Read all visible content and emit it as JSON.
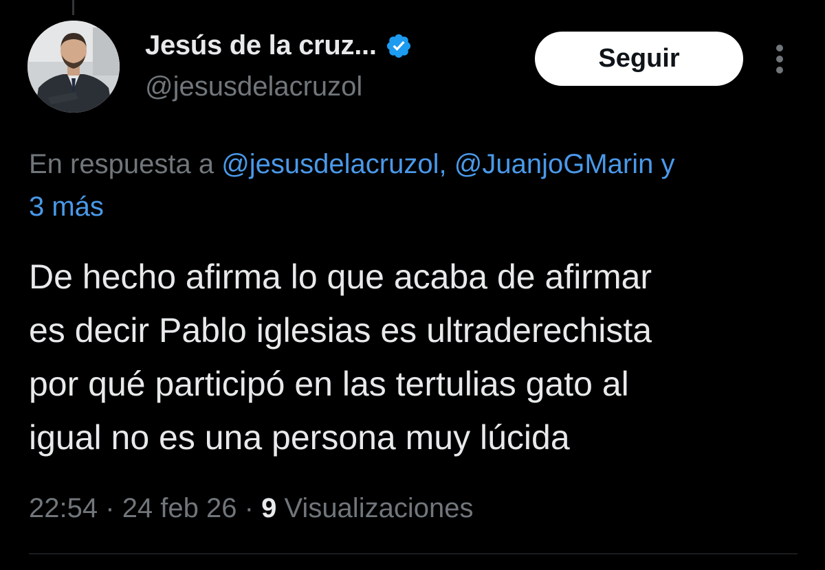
{
  "author": {
    "display_name": "Jesús de la cruz...",
    "handle": "@jesusdelacruzol",
    "verified": true
  },
  "follow_button": {
    "label": "Seguir"
  },
  "reply_context": {
    "prefix": "En respuesta a",
    "mentions": [
      "@jesusdelacruzol,",
      "@JuanjoGMarin y"
    ],
    "more": "3 más"
  },
  "tweet": {
    "lines": [
      "De hecho afirma lo que acaba de afirmar",
      "es decir Pablo iglesias es ultraderechista",
      "por qué participó en las tertulias gato al",
      "igual no es una persona muy lúcida"
    ]
  },
  "meta": {
    "time": "22:54",
    "separator": "·",
    "date": "24 feb 26",
    "views_count": "9",
    "views_label": "Visualizaciones"
  },
  "icons": {
    "verified": "verified-badge-icon",
    "more": "more-options-icon"
  },
  "colors": {
    "background": "#000000",
    "text": "#e7e9ea",
    "secondary": "#71767b",
    "link": "#4a99e9",
    "verified": "#1d9bf0"
  }
}
